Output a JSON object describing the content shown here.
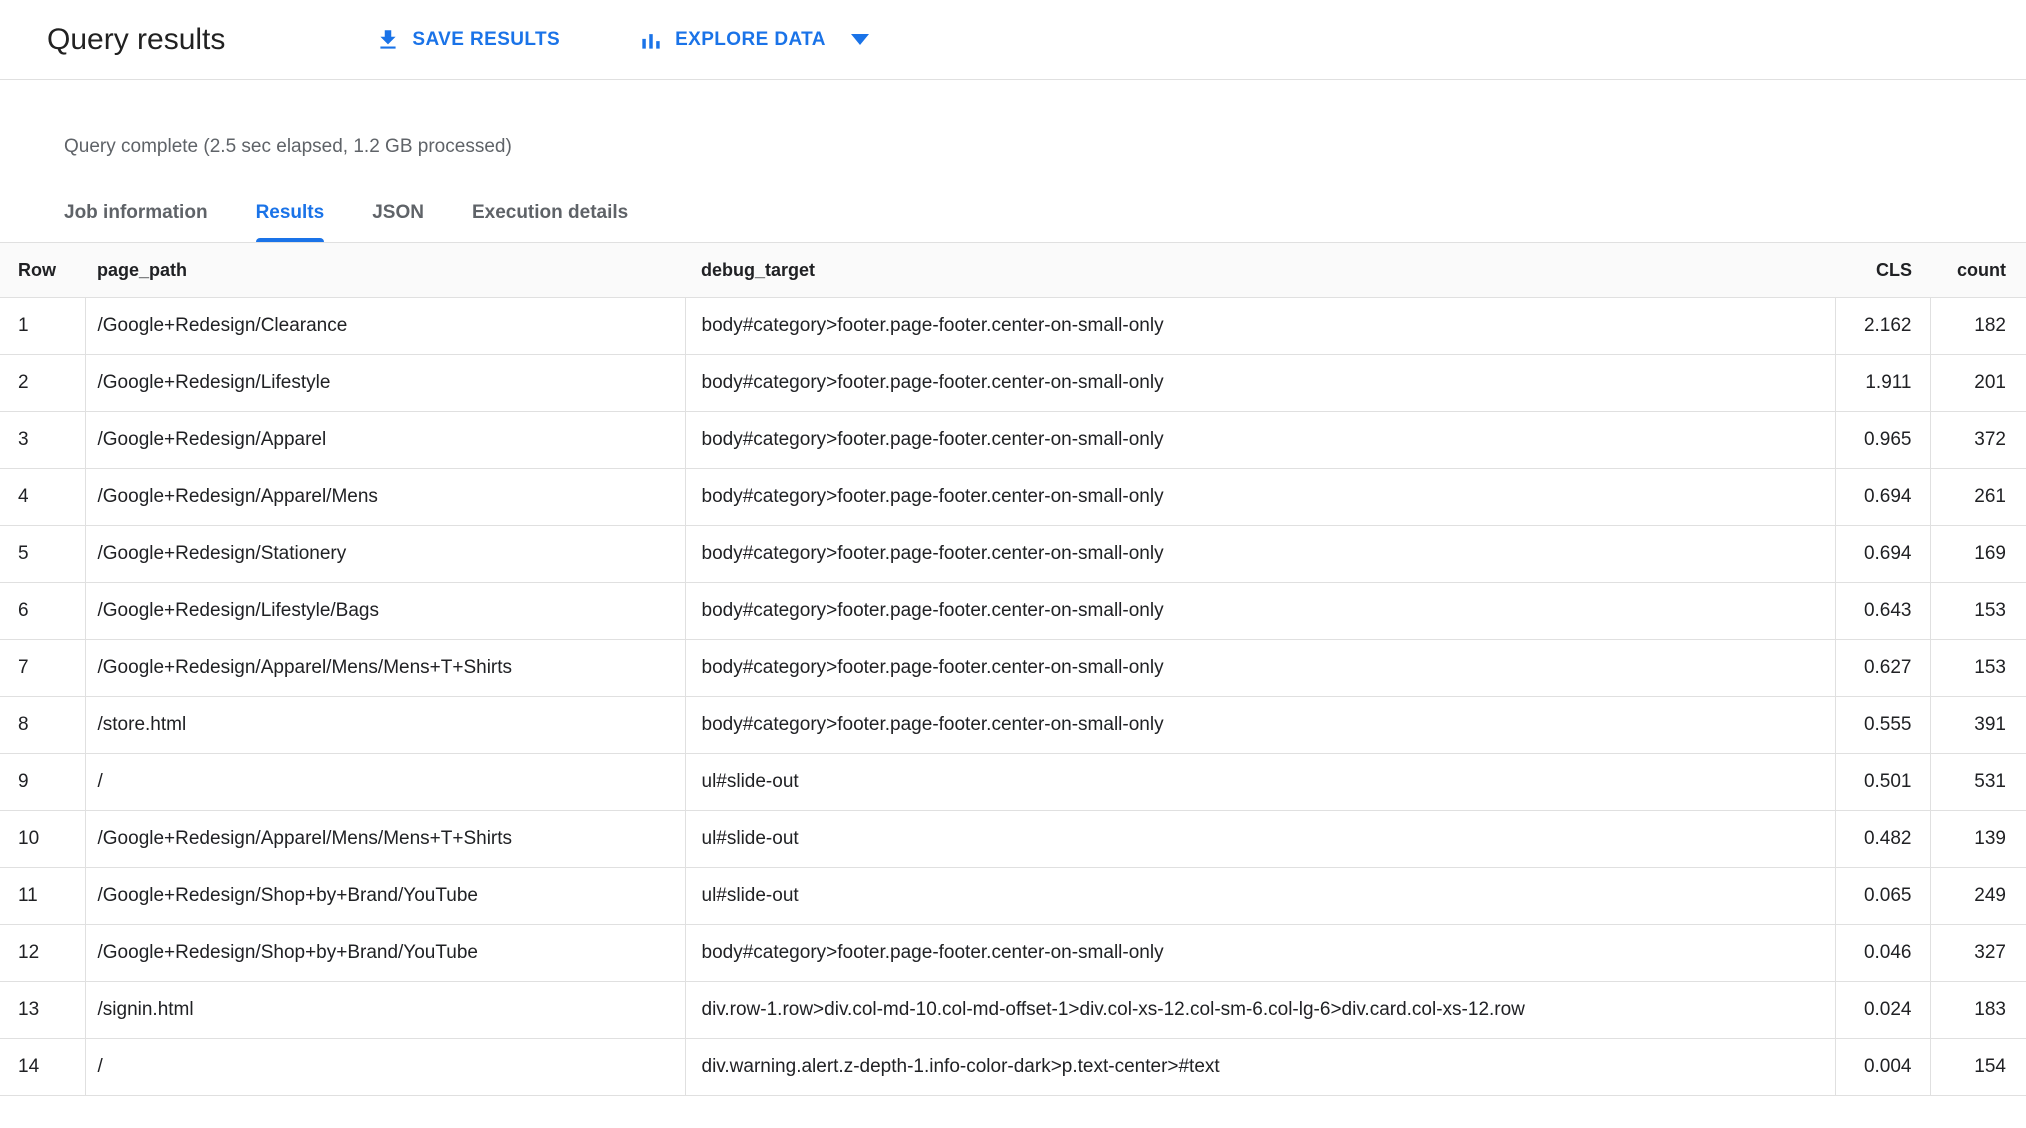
{
  "header": {
    "title": "Query results",
    "save_button": {
      "label": "SAVE RESULTS",
      "icon": "download-icon"
    },
    "explore_button": {
      "label": "EXPLORE DATA",
      "icon": "bar-chart-icon",
      "caret": "caret-down-icon"
    }
  },
  "status": "Query complete (2.5 sec elapsed, 1.2 GB processed)",
  "tabs": [
    {
      "label": "Job information",
      "active": false
    },
    {
      "label": "Results",
      "active": true
    },
    {
      "label": "JSON",
      "active": false
    },
    {
      "label": "Execution details",
      "active": false
    }
  ],
  "table": {
    "columns": [
      "Row",
      "page_path",
      "debug_target",
      "CLS",
      "count"
    ],
    "rows": [
      {
        "row": "1",
        "page_path": "/Google+Redesign/Clearance",
        "debug_target": "body#category>footer.page-footer.center-on-small-only",
        "cls": "2.162",
        "count": "182"
      },
      {
        "row": "2",
        "page_path": "/Google+Redesign/Lifestyle",
        "debug_target": "body#category>footer.page-footer.center-on-small-only",
        "cls": "1.911",
        "count": "201"
      },
      {
        "row": "3",
        "page_path": "/Google+Redesign/Apparel",
        "debug_target": "body#category>footer.page-footer.center-on-small-only",
        "cls": "0.965",
        "count": "372"
      },
      {
        "row": "4",
        "page_path": "/Google+Redesign/Apparel/Mens",
        "debug_target": "body#category>footer.page-footer.center-on-small-only",
        "cls": "0.694",
        "count": "261"
      },
      {
        "row": "5",
        "page_path": "/Google+Redesign/Stationery",
        "debug_target": "body#category>footer.page-footer.center-on-small-only",
        "cls": "0.694",
        "count": "169"
      },
      {
        "row": "6",
        "page_path": "/Google+Redesign/Lifestyle/Bags",
        "debug_target": "body#category>footer.page-footer.center-on-small-only",
        "cls": "0.643",
        "count": "153"
      },
      {
        "row": "7",
        "page_path": "/Google+Redesign/Apparel/Mens/Mens+T+Shirts",
        "debug_target": "body#category>footer.page-footer.center-on-small-only",
        "cls": "0.627",
        "count": "153"
      },
      {
        "row": "8",
        "page_path": "/store.html",
        "debug_target": "body#category>footer.page-footer.center-on-small-only",
        "cls": "0.555",
        "count": "391"
      },
      {
        "row": "9",
        "page_path": "/",
        "debug_target": "ul#slide-out",
        "cls": "0.501",
        "count": "531"
      },
      {
        "row": "10",
        "page_path": "/Google+Redesign/Apparel/Mens/Mens+T+Shirts",
        "debug_target": "ul#slide-out",
        "cls": "0.482",
        "count": "139"
      },
      {
        "row": "11",
        "page_path": "/Google+Redesign/Shop+by+Brand/YouTube",
        "debug_target": "ul#slide-out",
        "cls": "0.065",
        "count": "249"
      },
      {
        "row": "12",
        "page_path": "/Google+Redesign/Shop+by+Brand/YouTube",
        "debug_target": "body#category>footer.page-footer.center-on-small-only",
        "cls": "0.046",
        "count": "327"
      },
      {
        "row": "13",
        "page_path": "/signin.html",
        "debug_target": "div.row-1.row>div.col-md-10.col-md-offset-1>div.col-xs-12.col-sm-6.col-lg-6>div.card.col-xs-12.row",
        "cls": "0.024",
        "count": "183"
      },
      {
        "row": "14",
        "page_path": "/",
        "debug_target": "div.warning.alert.z-depth-1.info-color-dark>p.text-center>#text",
        "cls": "0.004",
        "count": "154"
      }
    ]
  },
  "colors": {
    "accent": "#1a73e8",
    "border": "#e0e0e0",
    "text": "#202124",
    "muted": "#5f6368"
  }
}
